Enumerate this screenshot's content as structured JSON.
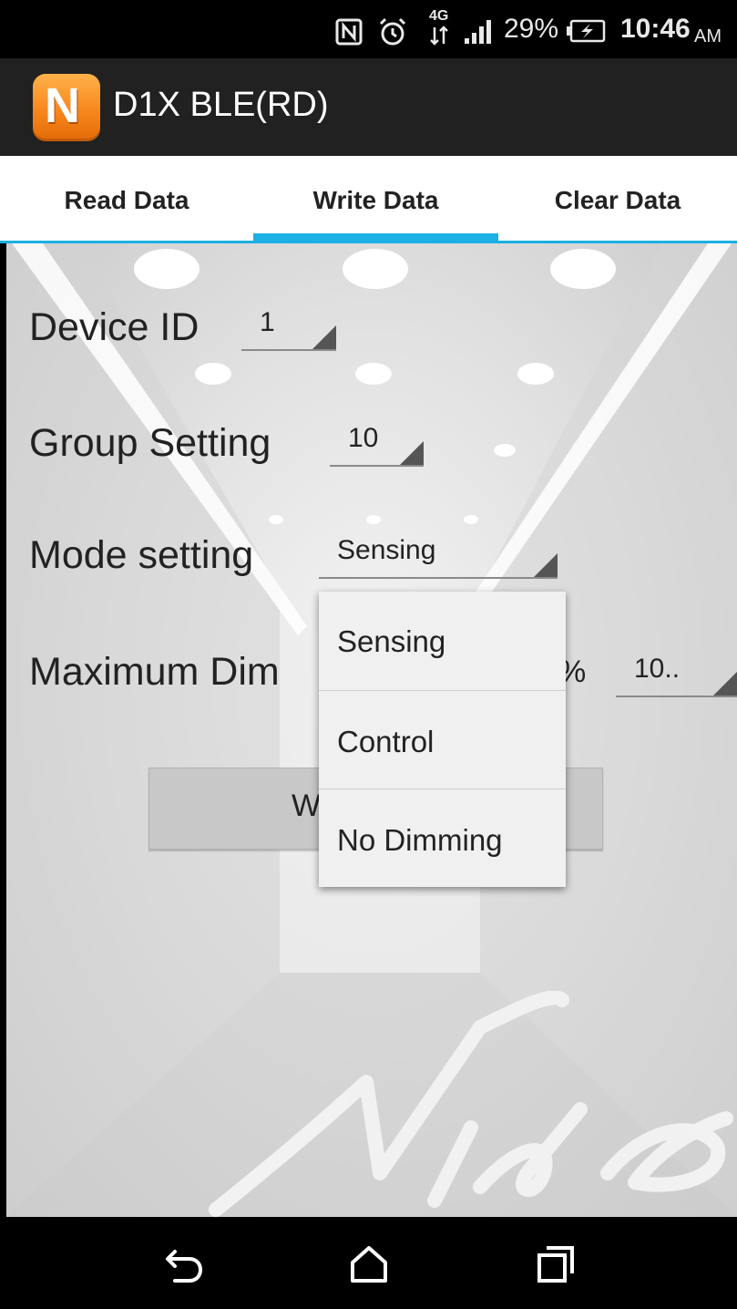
{
  "status_bar": {
    "battery": "29%",
    "time": "10:46",
    "ampm": "AM",
    "network": "4G",
    "icons": [
      "nfc-icon",
      "alarm-icon",
      "data-arrows-icon",
      "signal-icon",
      "battery-charging-icon"
    ]
  },
  "app": {
    "icon_letter": "N",
    "title": "D1X BLE(RD)"
  },
  "tabs": [
    {
      "label": "Read Data",
      "selected": false
    },
    {
      "label": "Write Data",
      "selected": true
    },
    {
      "label": "Clear Data",
      "selected": false
    }
  ],
  "accent_color": "#1db0e4",
  "form": {
    "device_id": {
      "label": "Device ID",
      "value": "1"
    },
    "group_setting": {
      "label": "Group Setting",
      "value": "10"
    },
    "mode_setting": {
      "label": "Mode setting",
      "value": "Sensing"
    },
    "maximum_dimming": {
      "label_visible": "Maximum Dim",
      "unit": "%",
      "value": "10.."
    },
    "write_button_visible": "W"
  },
  "dropdown": {
    "options": [
      "Sensing",
      "Control",
      "No Dimming"
    ]
  },
  "watermark": "Nido",
  "nav": {
    "back": "back-icon",
    "home": "home-icon",
    "recents": "recents-icon"
  }
}
